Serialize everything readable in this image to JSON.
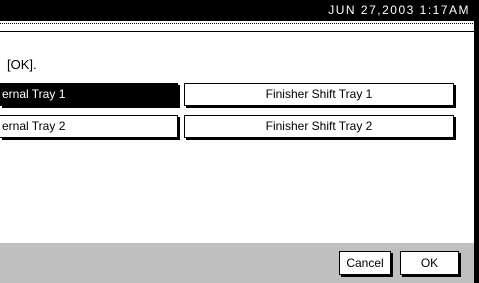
{
  "header": {
    "datetime": "JUN  27,2003  1:17AM"
  },
  "dialog": {
    "instruction": "[OK].",
    "trays": [
      {
        "label": "ernal Tray 1",
        "selected": true
      },
      {
        "label": "Finisher Shift Tray 1",
        "selected": false
      },
      {
        "label": "ernal Tray 2",
        "selected": false
      },
      {
        "label": "Finisher Shift Tray 2",
        "selected": false
      }
    ]
  },
  "footer": {
    "cancel_label": "Cancel",
    "ok_label": "OK"
  }
}
